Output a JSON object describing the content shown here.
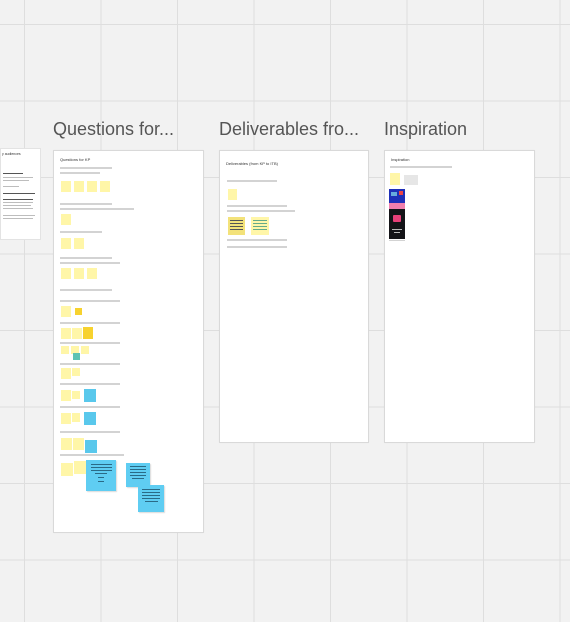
{
  "board": {
    "frames": [
      {
        "id": "questions",
        "title": "Questions for...",
        "inner_title": "Questions for KP"
      },
      {
        "id": "deliverables",
        "title": "Deliverables fro...",
        "inner_title": "Deliverables (from KP to ITB)"
      },
      {
        "id": "inspiration",
        "title": "Inspiration",
        "inner_title": "Inspiration"
      }
    ],
    "left_note": {
      "title": "y audiences"
    }
  }
}
